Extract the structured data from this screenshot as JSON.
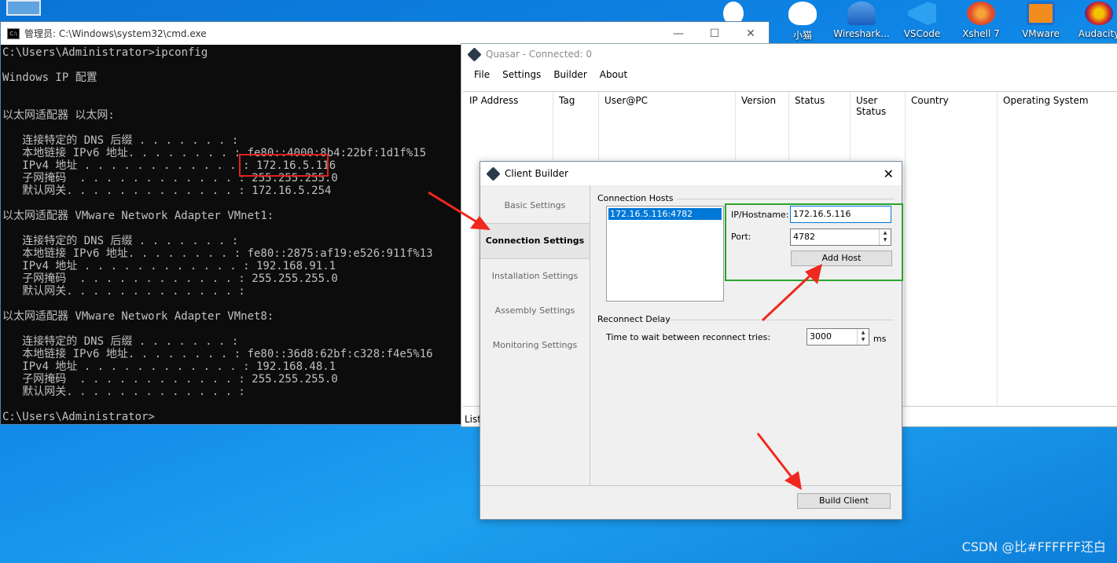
{
  "desktop": {
    "icons": [
      {
        "label": "小猫",
        "icon": "cat-app-icon",
        "color": "#ffffff"
      },
      {
        "label": "Wireshark...",
        "icon": "wireshark-icon",
        "color": "#1a6fd1"
      },
      {
        "label": "VSCode",
        "icon": "vscode-icon",
        "color": "#2da0f0"
      },
      {
        "label": "Xshell 7",
        "icon": "xshell-icon",
        "color": "#e04a2a"
      },
      {
        "label": "VMware",
        "icon": "vmware-icon",
        "color": "#f28c1e"
      },
      {
        "label": "Audacity",
        "icon": "audacity-icon",
        "color": "#d02030"
      }
    ]
  },
  "cmd": {
    "title": "管理员: C:\\Windows\\system32\\cmd.exe",
    "lines": [
      "C:\\Users\\Administrator>ipconfig",
      "",
      "Windows IP 配置",
      "",
      "",
      "以太网适配器 以太网:",
      "",
      "   连接特定的 DNS 后缀 . . . . . . . :",
      "   本地链接 IPv6 地址. . . . . . . . : fe80::4000:8b4:22bf:1d1f%15",
      "   IPv4 地址 . . . . . . . . . . . . : 172.16.5.116",
      "   子网掩码  . . . . . . . . . . . . : 255.255.255.0",
      "   默认网关. . . . . . . . . . . . . : 172.16.5.254",
      "",
      "以太网适配器 VMware Network Adapter VMnet1:",
      "",
      "   连接特定的 DNS 后缀 . . . . . . . :",
      "   本地链接 IPv6 地址. . . . . . . . : fe80::2875:af19:e526:911f%13",
      "   IPv4 地址 . . . . . . . . . . . . : 192.168.91.1",
      "   子网掩码  . . . . . . . . . . . . : 255.255.255.0",
      "   默认网关. . . . . . . . . . . . . :",
      "",
      "以太网适配器 VMware Network Adapter VMnet8:",
      "",
      "   连接特定的 DNS 后缀 . . . . . . . :",
      "   本地链接 IPv6 地址. . . . . . . . : fe80::36d8:62bf:c328:f4e5%16",
      "   IPv4 地址 . . . . . . . . . . . . : 192.168.48.1",
      "   子网掩码  . . . . . . . . . . . . : 255.255.255.0",
      "   默认网关. . . . . . . . . . . . . :",
      "",
      "C:\\Users\\Administrator>"
    ]
  },
  "quasar": {
    "title": "Quasar - Connected: 0",
    "menu": [
      "File",
      "Settings",
      "Builder",
      "About"
    ],
    "columns": [
      "IP Address",
      "Tag",
      "User@PC",
      "Version",
      "Status",
      "User Status",
      "Country",
      "Operating System"
    ],
    "status": "Liste"
  },
  "builder": {
    "title": "Client Builder",
    "nav": [
      "Basic Settings",
      "Connection Settings",
      "Installation Settings",
      "Assembly Settings",
      "Monitoring Settings"
    ],
    "active_nav": "Connection Settings",
    "connection_hosts_label": "Connection Hosts",
    "hosts": [
      "172.16.5.116:4782"
    ],
    "ip_label": "IP/Hostname:",
    "ip_value": "172.16.5.116",
    "port_label": "Port:",
    "port_value": "4782",
    "add_host": "Add Host",
    "reconnect_label": "Reconnect Delay",
    "wait_label": "Time to wait between reconnect tries:",
    "wait_value": "3000",
    "wait_unit": "ms",
    "build_button": "Build Client"
  },
  "watermark": "CSDN @比#FFFFFF还白",
  "colors": {
    "highlight_red": "#e02020",
    "highlight_green": "#2aa52a",
    "selection": "#0078d7"
  }
}
